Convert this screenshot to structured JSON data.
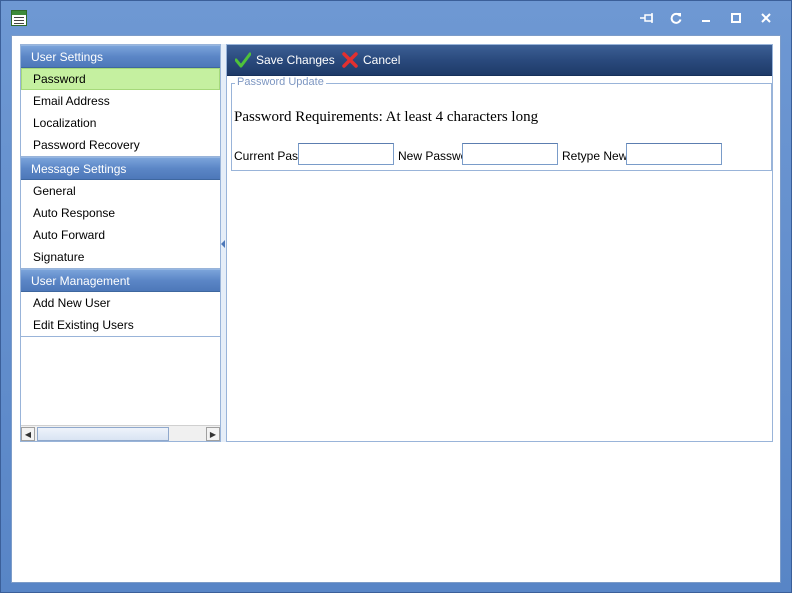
{
  "window": {
    "title_icon": "app-form-icon",
    "buttons": [
      "pin-icon",
      "refresh-icon",
      "minimize-icon",
      "maximize-icon",
      "close-icon"
    ]
  },
  "sidebar": {
    "groups": [
      {
        "header": "User Settings",
        "items": [
          {
            "label": "Password",
            "selected": true
          },
          {
            "label": "Email Address"
          },
          {
            "label": "Localization"
          },
          {
            "label": "Password Recovery"
          }
        ]
      },
      {
        "header": "Message Settings",
        "items": [
          {
            "label": "General"
          },
          {
            "label": "Auto Response"
          },
          {
            "label": "Auto Forward"
          },
          {
            "label": "Signature"
          }
        ]
      },
      {
        "header": "User Management",
        "items": [
          {
            "label": "Add New User"
          },
          {
            "label": "Edit Existing Users"
          }
        ]
      }
    ]
  },
  "toolbar": {
    "save_label": "Save Changes",
    "cancel_label": "Cancel"
  },
  "form": {
    "legend": "Password Update",
    "requirements": "Password Requirements: At least 4 characters long",
    "current_label": "Current Pass",
    "new_label": "New Passwc",
    "retype_label": "Retype New",
    "current_value": "",
    "new_value": "",
    "retype_value": ""
  },
  "colors": {
    "frame": "#5885c6",
    "selected_item": "#c5f0a0",
    "toolbar": "#2a4a7d"
  }
}
